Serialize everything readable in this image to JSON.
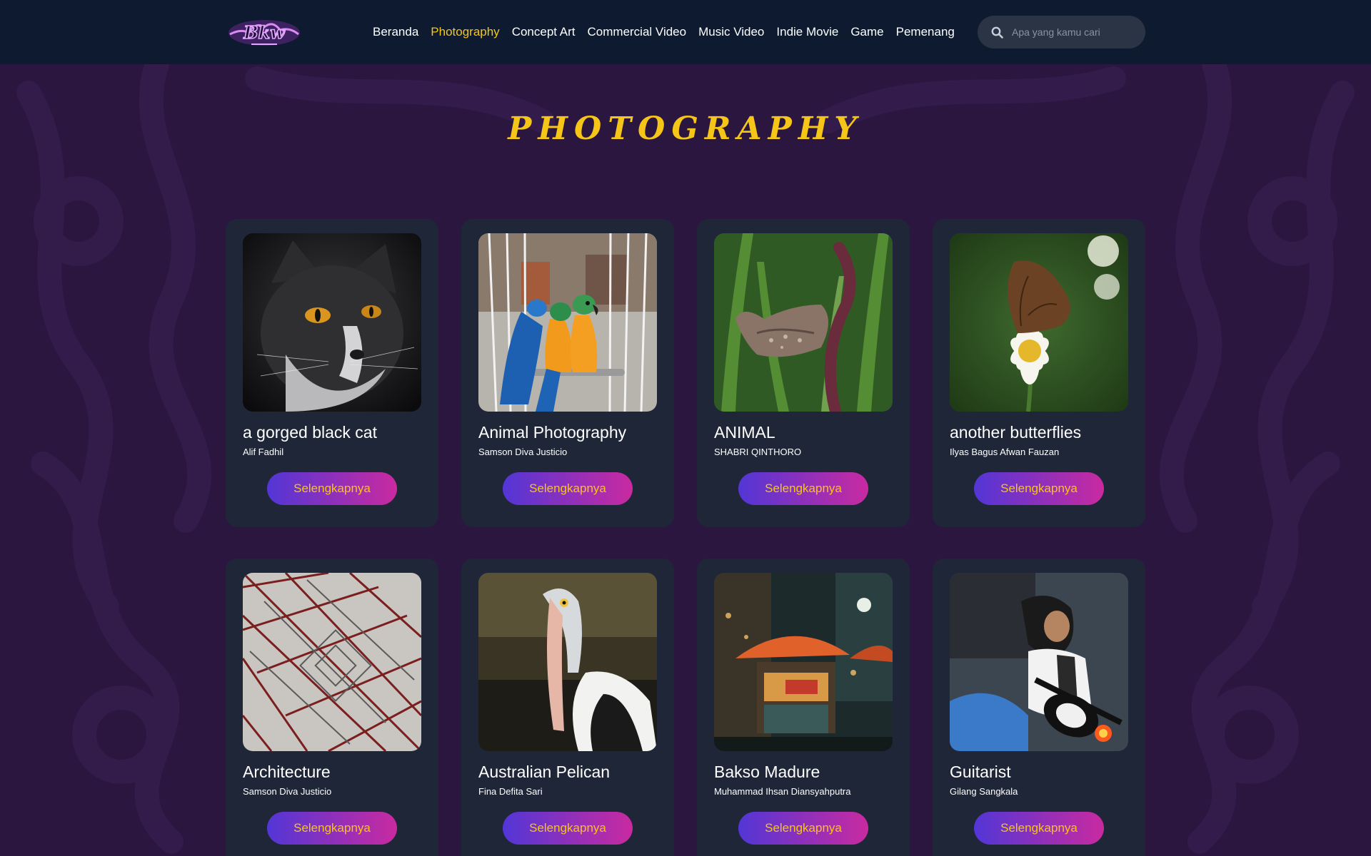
{
  "nav": {
    "items": [
      {
        "label": "Beranda",
        "active": false
      },
      {
        "label": "Photography",
        "active": true
      },
      {
        "label": "Concept Art",
        "active": false
      },
      {
        "label": "Commercial Video",
        "active": false
      },
      {
        "label": "Music Video",
        "active": false
      },
      {
        "label": "Indie Movie",
        "active": false
      },
      {
        "label": "Game",
        "active": false
      },
      {
        "label": "Pemenang",
        "active": false
      }
    ],
    "search_placeholder": "Apa yang kamu cari"
  },
  "page": {
    "title": "PHOTOGRAPHY"
  },
  "cards": [
    {
      "title": "a gorged black cat",
      "author": "Alif Fadhil",
      "button": "Selengkapnya",
      "image": "cat-photo"
    },
    {
      "title": "Animal Photography",
      "author": "Samson Diva Justicio",
      "button": "Selengkapnya",
      "image": "parrots-photo"
    },
    {
      "title": "ANIMAL",
      "author": "SHABRI QINTHORO",
      "button": "Selengkapnya",
      "image": "butterfly-on-stem-photo"
    },
    {
      "title": "another butterflies",
      "author": "Ilyas Bagus Afwan Fauzan",
      "button": "Selengkapnya",
      "image": "butterfly-on-flower-photo"
    },
    {
      "title": "Architecture",
      "author": "Samson Diva Justicio",
      "button": "Selengkapnya",
      "image": "tower-photo"
    },
    {
      "title": "Australian Pelican",
      "author": "Fina Defita Sari",
      "button": "Selengkapnya",
      "image": "pelican-photo"
    },
    {
      "title": "Bakso Madure",
      "author": "Muhammad Ihsan Diansyahputra",
      "button": "Selengkapnya",
      "image": "street-food-photo"
    },
    {
      "title": "Guitarist",
      "author": "Gilang Sangkala",
      "button": "Selengkapnya",
      "image": "guitarist-photo"
    }
  ],
  "colors": {
    "background": "#2b1640",
    "navbar": "#0d1a30",
    "card": "#1f2638",
    "accent": "#f5c518",
    "button_gradient_start": "#5236d6",
    "button_gradient_end": "#c92aa0"
  }
}
